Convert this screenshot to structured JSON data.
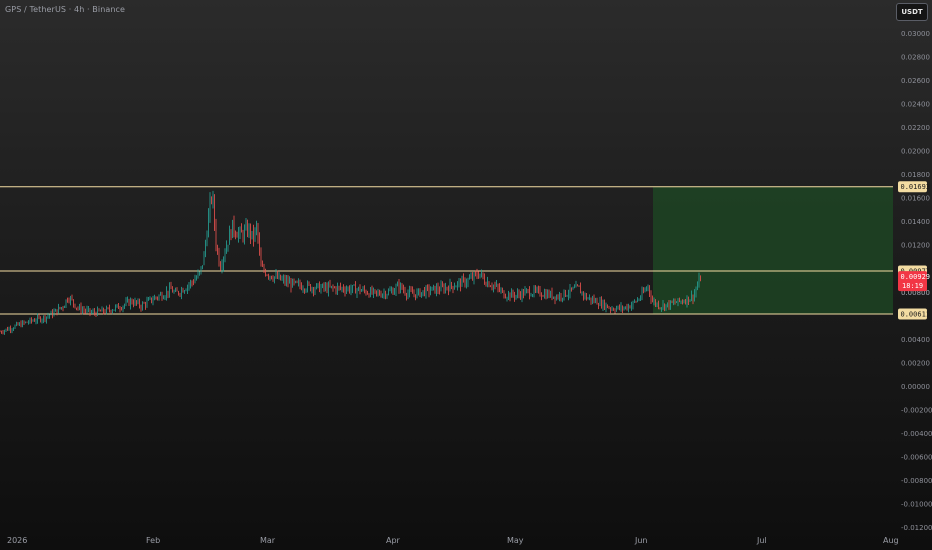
{
  "header": {
    "title": "GPS / TetherUS · 4h · Binance",
    "currency_button": "USDT"
  },
  "colors": {
    "level_line": "#f3dca2",
    "up_candle": "#26a69a",
    "down_candle": "#ef5350",
    "target_zone": "#1e4a24",
    "current_price_tag": "#f23645"
  },
  "chart_data": {
    "type": "candlestick",
    "symbol": "GPS/USDT",
    "interval": "4h",
    "exchange": "Binance",
    "y_ticks": [
      "0.03000",
      "0.02800",
      "0.02600",
      "0.02400",
      "0.02200",
      "0.02000",
      "0.01800",
      "0.01600",
      "0.01400",
      "0.01200",
      "0.00800",
      "0.00400",
      "0.00200",
      "0.00000",
      "-0.00200",
      "-0.00400",
      "-0.00600",
      "-0.00800",
      "-0.01000",
      "-0.01200"
    ],
    "y_tick_values": [
      0.03,
      0.028,
      0.026,
      0.024,
      0.022,
      0.02,
      0.018,
      0.016,
      0.014,
      0.012,
      0.008,
      0.004,
      0.002,
      0,
      -0.002,
      -0.004,
      -0.006,
      -0.008,
      -0.01,
      -0.012
    ],
    "ylim": [
      -0.0122,
      0.0322
    ],
    "x_labels": [
      "2026",
      "Feb",
      "Mar",
      "Apr",
      "May",
      "Jun",
      "Jul",
      "Aug"
    ],
    "levels": [
      {
        "label": "0.01693",
        "value": 0.01693
      },
      {
        "label": "0.00977",
        "value": 0.00977
      },
      {
        "label": "0.00611",
        "value": 0.00611
      }
    ],
    "current_price": {
      "label": "0.00929",
      "value": 0.00929,
      "countdown": "18:19"
    },
    "partial_tick_label": "0.00800",
    "target_zone": {
      "from_date": "Jun",
      "low": 0.00611,
      "high": 0.01693
    },
    "price_path": [
      [
        "2026-01-01",
        0.0046
      ],
      [
        "2026-01-05",
        0.0052
      ],
      [
        "2026-01-08",
        0.0056
      ],
      [
        "2026-01-10",
        0.0058
      ],
      [
        "2026-01-12",
        0.0062
      ],
      [
        "2026-01-14",
        0.0068
      ],
      [
        "2026-01-15",
        0.0076
      ],
      [
        "2026-01-17",
        0.0066
      ],
      [
        "2026-01-20",
        0.0062
      ],
      [
        "2026-01-23",
        0.0064
      ],
      [
        "2026-01-26",
        0.0068
      ],
      [
        "2026-01-28",
        0.0072
      ],
      [
        "2026-01-30",
        0.0068
      ],
      [
        "2026-02-02",
        0.0075
      ],
      [
        "2026-02-04",
        0.0078
      ],
      [
        "2026-02-06",
        0.0082
      ],
      [
        "2026-02-07",
        0.0078
      ],
      [
        "2026-02-09",
        0.0083
      ],
      [
        "2026-02-11",
        0.0088
      ],
      [
        "2026-02-13",
        0.0095
      ],
      [
        "2026-02-14",
        0.011
      ],
      [
        "2026-02-15",
        0.014
      ],
      [
        "2026-02-16",
        0.0165
      ],
      [
        "2026-02-17",
        0.012
      ],
      [
        "2026-02-18",
        0.0102
      ],
      [
        "2026-02-20",
        0.0125
      ],
      [
        "2026-02-21",
        0.0135
      ],
      [
        "2026-02-23",
        0.0128
      ],
      [
        "2026-02-25",
        0.0133
      ],
      [
        "2026-02-26",
        0.0125
      ],
      [
        "2026-02-27",
        0.0135
      ],
      [
        "2026-02-28",
        0.01
      ],
      [
        "2026-03-02",
        0.0095
      ],
      [
        "2026-03-05",
        0.009
      ],
      [
        "2026-03-08",
        0.0086
      ],
      [
        "2026-03-12",
        0.0084
      ],
      [
        "2026-03-16",
        0.0083
      ],
      [
        "2026-03-20",
        0.0083
      ],
      [
        "2026-03-24",
        0.0082
      ],
      [
        "2026-03-28",
        0.0078
      ],
      [
        "2026-04-01",
        0.008
      ],
      [
        "2026-04-03",
        0.0085
      ],
      [
        "2026-04-05",
        0.0079
      ],
      [
        "2026-04-07",
        0.0078
      ],
      [
        "2026-04-10",
        0.0081
      ],
      [
        "2026-04-14",
        0.0083
      ],
      [
        "2026-04-18",
        0.0087
      ],
      [
        "2026-04-21",
        0.0091
      ],
      [
        "2026-04-23",
        0.0096
      ],
      [
        "2026-04-24",
        0.009
      ],
      [
        "2026-04-27",
        0.0084
      ],
      [
        "2026-04-29",
        0.0078
      ],
      [
        "2026-05-02",
        0.0077
      ],
      [
        "2026-05-05",
        0.008
      ],
      [
        "2026-05-08",
        0.0079
      ],
      [
        "2026-05-12",
        0.0076
      ],
      [
        "2026-05-15",
        0.008
      ],
      [
        "2026-05-17",
        0.0083
      ],
      [
        "2026-05-19",
        0.0075
      ],
      [
        "2026-05-22",
        0.0071
      ],
      [
        "2026-05-25",
        0.0066
      ],
      [
        "2026-05-28",
        0.0066
      ],
      [
        "2026-05-30",
        0.0069
      ],
      [
        "2026-06-01",
        0.0075
      ],
      [
        "2026-06-03",
        0.0085
      ],
      [
        "2026-06-04",
        0.0072
      ],
      [
        "2026-06-06",
        0.0068
      ],
      [
        "2026-06-08",
        0.0069
      ],
      [
        "2026-06-10",
        0.0071
      ],
      [
        "2026-06-12",
        0.0073
      ],
      [
        "2026-06-14",
        0.0076
      ],
      [
        "2026-06-15",
        0.0084
      ],
      [
        "2026-06-16",
        0.00929
      ]
    ]
  }
}
